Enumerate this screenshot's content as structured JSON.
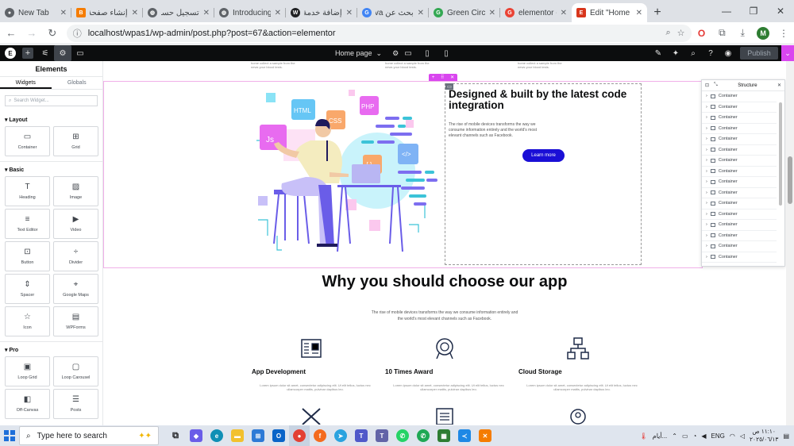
{
  "browser": {
    "tabs": [
      {
        "title": "New Tab",
        "favicon": "chrome-icon",
        "color": "#5f6368"
      },
      {
        "title": "إنشاء صفحة",
        "favicon": "blogger-icon",
        "color": "#f57c00"
      },
      {
        "title": "تسجيل حساب",
        "favicon": "globe-icon",
        "color": "#5f6368"
      },
      {
        "title": "Introducing G",
        "favicon": "globe-icon",
        "color": "#5f6368"
      },
      {
        "title": "إضافة خدمة",
        "favicon": "wordpress-icon",
        "color": "#202124"
      },
      {
        "title": "بحث عن Canva",
        "favicon": "google-icon",
        "color": "#4285f4"
      },
      {
        "title": "Green Circle",
        "favicon": "google-icon",
        "color": "#34a853"
      },
      {
        "title": "elementor -",
        "favicon": "google-icon",
        "color": "#ea4335"
      },
      {
        "title": "Edit \"Home p",
        "favicon": "elementor-icon",
        "color": "#d8361c"
      }
    ],
    "url": "localhost/wpas1/wp-admin/post.php?post=67&action=elementor",
    "profile_initial": "M"
  },
  "elementor_bar": {
    "page_selector": "Home page",
    "publish_label": "Publish"
  },
  "panel": {
    "title": "Elements",
    "tabs": [
      "Widgets",
      "Globals"
    ],
    "search_placeholder": "Search Widget...",
    "categories": {
      "layout": {
        "label": "Layout",
        "widgets": [
          {
            "label": "Container",
            "icon": "▭"
          },
          {
            "label": "Grid",
            "icon": "⊞"
          }
        ]
      },
      "basic": {
        "label": "Basic",
        "widgets": [
          {
            "label": "Heading",
            "icon": "T"
          },
          {
            "label": "Image",
            "icon": "▨"
          },
          {
            "label": "Text Editor",
            "icon": "≡"
          },
          {
            "label": "Video",
            "icon": "▶"
          },
          {
            "label": "Button",
            "icon": "⊡"
          },
          {
            "label": "Divider",
            "icon": "÷"
          },
          {
            "label": "Spacer",
            "icon": "⇕"
          },
          {
            "label": "Google Maps",
            "icon": "⌖"
          },
          {
            "label": "Icon",
            "icon": "☆"
          },
          {
            "label": "WPForms",
            "icon": "▤"
          }
        ]
      },
      "pro": {
        "label": "Pro",
        "widgets": [
          {
            "label": "Loop Grid",
            "icon": "▣"
          },
          {
            "label": "Loop Carousel",
            "icon": "▢"
          },
          {
            "label": "Off-Canvas",
            "icon": "◧"
          },
          {
            "label": "Posts",
            "icon": "☰"
          }
        ]
      }
    }
  },
  "canvas": {
    "top_snippets": [
      "home collect a sample from the news your blood tests.",
      "home collect a sample from the news your blood tests.",
      "home collect a sample from the news your blood tests."
    ],
    "hero": {
      "title": "Designed & built by the latest code integration",
      "body": "The rise of mobile devices transforms the way we consume information entirely and the world's most elevant channels such as Facebook.",
      "button": "Learn more"
    },
    "why_title": "Why you should choose our app",
    "why_subtitle": "The rise of mobile devices transforms the way we consume information entirely and the world's most elevant channels such as Facebook.",
    "features": [
      {
        "title": "App Development",
        "body": "Lorem ipsum dolor sit amet, consectetur adipiscing elit. Ut elit tellus, luctus nec ullamcorper mattis, pulvinar dapibus leo."
      },
      {
        "title": "10 Times Award",
        "body": "Lorem ipsum dolor sit amet, consectetur adipiscing elit. Ut elit tellus, luctus nec ullamcorper mattis, pulvinar dapibus leo."
      },
      {
        "title": "Cloud Storage",
        "body": "Lorem ipsum dolor sit amet, consectetur adipiscing elit. Ut elit tellus, luctus nec ullamcorper mattis, pulvinar dapibus leo."
      }
    ],
    "illustration_labels": {
      "html": "HTML",
      "css": "CSS",
      "php": "PHP",
      "js": "Js",
      "code": "</>",
      "braces": "{ }"
    }
  },
  "structure": {
    "title": "Structure",
    "items": [
      "Container",
      "Container",
      "Container",
      "Container",
      "Container",
      "Container",
      "Container",
      "Container",
      "Container",
      "Container",
      "Container",
      "Container",
      "Container",
      "Container",
      "Container",
      "Container"
    ]
  },
  "taskbar": {
    "search_placeholder": "Type here to search",
    "weather": "أيام...",
    "language": "ENG",
    "time": "١١:١٠ ص",
    "date": "٢٠٢٥/٠٦/١٣"
  }
}
